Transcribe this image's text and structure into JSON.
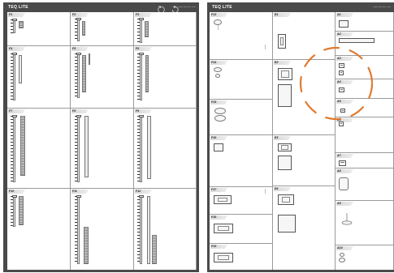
{
  "left_sheet": {
    "title": "TEQ LITE",
    "tiny_text": "www.teq-lite.com",
    "icons": [
      "rotate-clockwise-icon",
      "rotate-counterclockwise-icon"
    ],
    "items": [
      "F1",
      "F2",
      "F3",
      "F4",
      "F5",
      "F6",
      "F7",
      "F8",
      "F9",
      "F10",
      "F11",
      "F12"
    ]
  },
  "right_sheet": {
    "title": "TEQ LITE",
    "tiny_text": "www.teq-lite.com",
    "col1": [
      "F13",
      "F14",
      "F15",
      "F16",
      "F17",
      "F18",
      "F19"
    ],
    "col2": [
      "E1",
      "E2",
      "E3",
      "E4"
    ],
    "col3": [
      "A1",
      "A2",
      "A3",
      "A4",
      "A5",
      "A6",
      "A7",
      "A8",
      "A9",
      "A10"
    ]
  },
  "colors": {
    "sheet_bg": "#4a4a4a",
    "highlight": "#e07a2e"
  }
}
